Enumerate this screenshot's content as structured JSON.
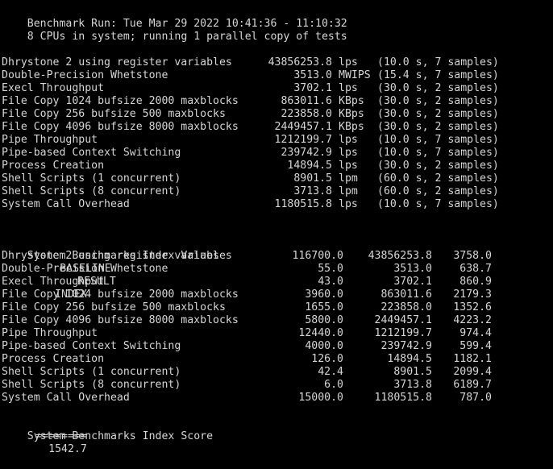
{
  "terminal": {
    "background_color": "#000000",
    "text_color": "#d6d6d6",
    "header": {
      "run_line": "Benchmark Run: Tue Mar 29 2022 10:41:36 - 11:10:32",
      "cpu_line": "8 CPUs in system; running 1 parallel copy of tests"
    },
    "results": {
      "rows": [
        {
          "name": "Dhrystone 2 using register variables",
          "value": "43856253.8",
          "unit": "lps",
          "samples": "(10.0 s, 7 samples)"
        },
        {
          "name": "Double-Precision Whetstone",
          "value": "3513.0",
          "unit": "MWIPS",
          "samples": "(15.4 s, 7 samples)"
        },
        {
          "name": "Execl Throughput",
          "value": "3702.1",
          "unit": "lps",
          "samples": "(30.0 s, 2 samples)"
        },
        {
          "name": "File Copy 1024 bufsize 2000 maxblocks",
          "value": "863011.6",
          "unit": "KBps",
          "samples": "(30.0 s, 2 samples)"
        },
        {
          "name": "File Copy 256 bufsize 500 maxblocks",
          "value": "223858.0",
          "unit": "KBps",
          "samples": "(30.0 s, 2 samples)"
        },
        {
          "name": "File Copy 4096 bufsize 8000 maxblocks",
          "value": "2449457.1",
          "unit": "KBps",
          "samples": "(30.0 s, 2 samples)"
        },
        {
          "name": "Pipe Throughput",
          "value": "1212199.7",
          "unit": "lps",
          "samples": "(10.0 s, 7 samples)"
        },
        {
          "name": "Pipe-based Context Switching",
          "value": "239742.9",
          "unit": "lps",
          "samples": "(10.0 s, 7 samples)"
        },
        {
          "name": "Process Creation",
          "value": "14894.5",
          "unit": "lps",
          "samples": "(30.0 s, 2 samples)"
        },
        {
          "name": "Shell Scripts (1 concurrent)",
          "value": "8901.5",
          "unit": "lpm",
          "samples": "(60.0 s, 2 samples)"
        },
        {
          "name": "Shell Scripts (8 concurrent)",
          "value": "3713.8",
          "unit": "lpm",
          "samples": "(60.0 s, 2 samples)"
        },
        {
          "name": "System Call Overhead",
          "value": "1180515.8",
          "unit": "lps",
          "samples": "(10.0 s, 7 samples)"
        }
      ]
    },
    "index_values": {
      "title": "System Benchmarks Index Values",
      "headers": {
        "baseline": "BASELINE",
        "result": "RESULT",
        "index": "INDEX"
      },
      "rows": [
        {
          "name": "Dhrystone 2 using register variables",
          "baseline": "116700.0",
          "result": "43856253.8",
          "index": "3758.0"
        },
        {
          "name": "Double-Precision Whetstone",
          "baseline": "55.0",
          "result": "3513.0",
          "index": "638.7"
        },
        {
          "name": "Execl Throughput",
          "baseline": "43.0",
          "result": "3702.1",
          "index": "860.9"
        },
        {
          "name": "File Copy 1024 bufsize 2000 maxblocks",
          "baseline": "3960.0",
          "result": "863011.6",
          "index": "2179.3"
        },
        {
          "name": "File Copy 256 bufsize 500 maxblocks",
          "baseline": "1655.0",
          "result": "223858.0",
          "index": "1352.6"
        },
        {
          "name": "File Copy 4096 bufsize 8000 maxblocks",
          "baseline": "5800.0",
          "result": "2449457.1",
          "index": "4223.2"
        },
        {
          "name": "Pipe Throughput",
          "baseline": "12440.0",
          "result": "1212199.7",
          "index": "974.4"
        },
        {
          "name": "Pipe-based Context Switching",
          "baseline": "4000.0",
          "result": "239742.9",
          "index": "599.4"
        },
        {
          "name": "Process Creation",
          "baseline": "126.0",
          "result": "14894.5",
          "index": "1182.1"
        },
        {
          "name": "Shell Scripts (1 concurrent)",
          "baseline": "42.4",
          "result": "8901.5",
          "index": "2099.4"
        },
        {
          "name": "Shell Scripts (8 concurrent)",
          "baseline": "6.0",
          "result": "3713.8",
          "index": "6189.7"
        },
        {
          "name": "System Call Overhead",
          "baseline": "15000.0",
          "result": "1180515.8",
          "index": "787.0"
        }
      ],
      "separator": "========",
      "score_label": "System Benchmarks Index Score",
      "score_value": "1542.7"
    }
  }
}
